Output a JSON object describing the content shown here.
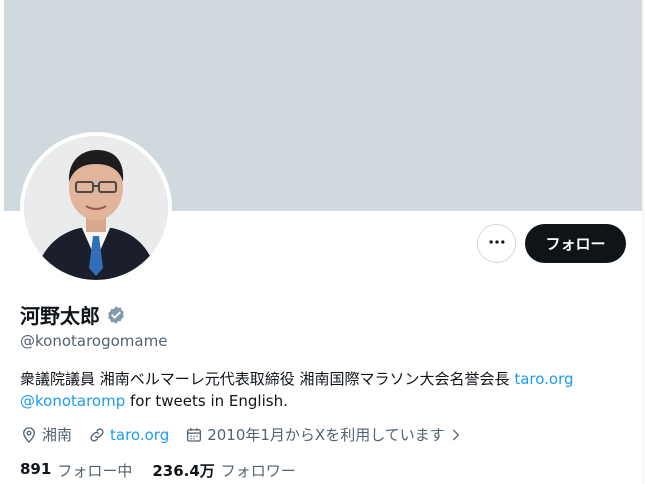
{
  "profile": {
    "name": "河野太郎",
    "handle": "@konotarogomame",
    "bio_text": "衆議院議員 湘南ベルマーレ元代表取締役 湘南国際マラソン大会名誉会長 ",
    "bio_link": "taro.org",
    "bio_mention": "@konotaromp",
    "bio_suffix": " for tweets in English.",
    "location": "湘南",
    "website": "taro.org",
    "joined": "2010年1月からXを利用しています",
    "following_count": "891",
    "following_label": "フォロー中",
    "followers_count": "236.4万",
    "followers_label": "フォロワー"
  },
  "actions": {
    "follow_label": "フォロー",
    "more_icon": "more-horizontal-icon"
  },
  "icons": {
    "verified": "verified-badge-icon",
    "location": "location-pin-icon",
    "link": "link-icon",
    "calendar": "calendar-icon",
    "chevron": "chevron-right-icon"
  },
  "colors": {
    "banner": "#cfd9de",
    "link": "#1d9bf0",
    "secondary_text": "#536471",
    "primary_text": "#0f1419",
    "verified": "#829aab"
  }
}
